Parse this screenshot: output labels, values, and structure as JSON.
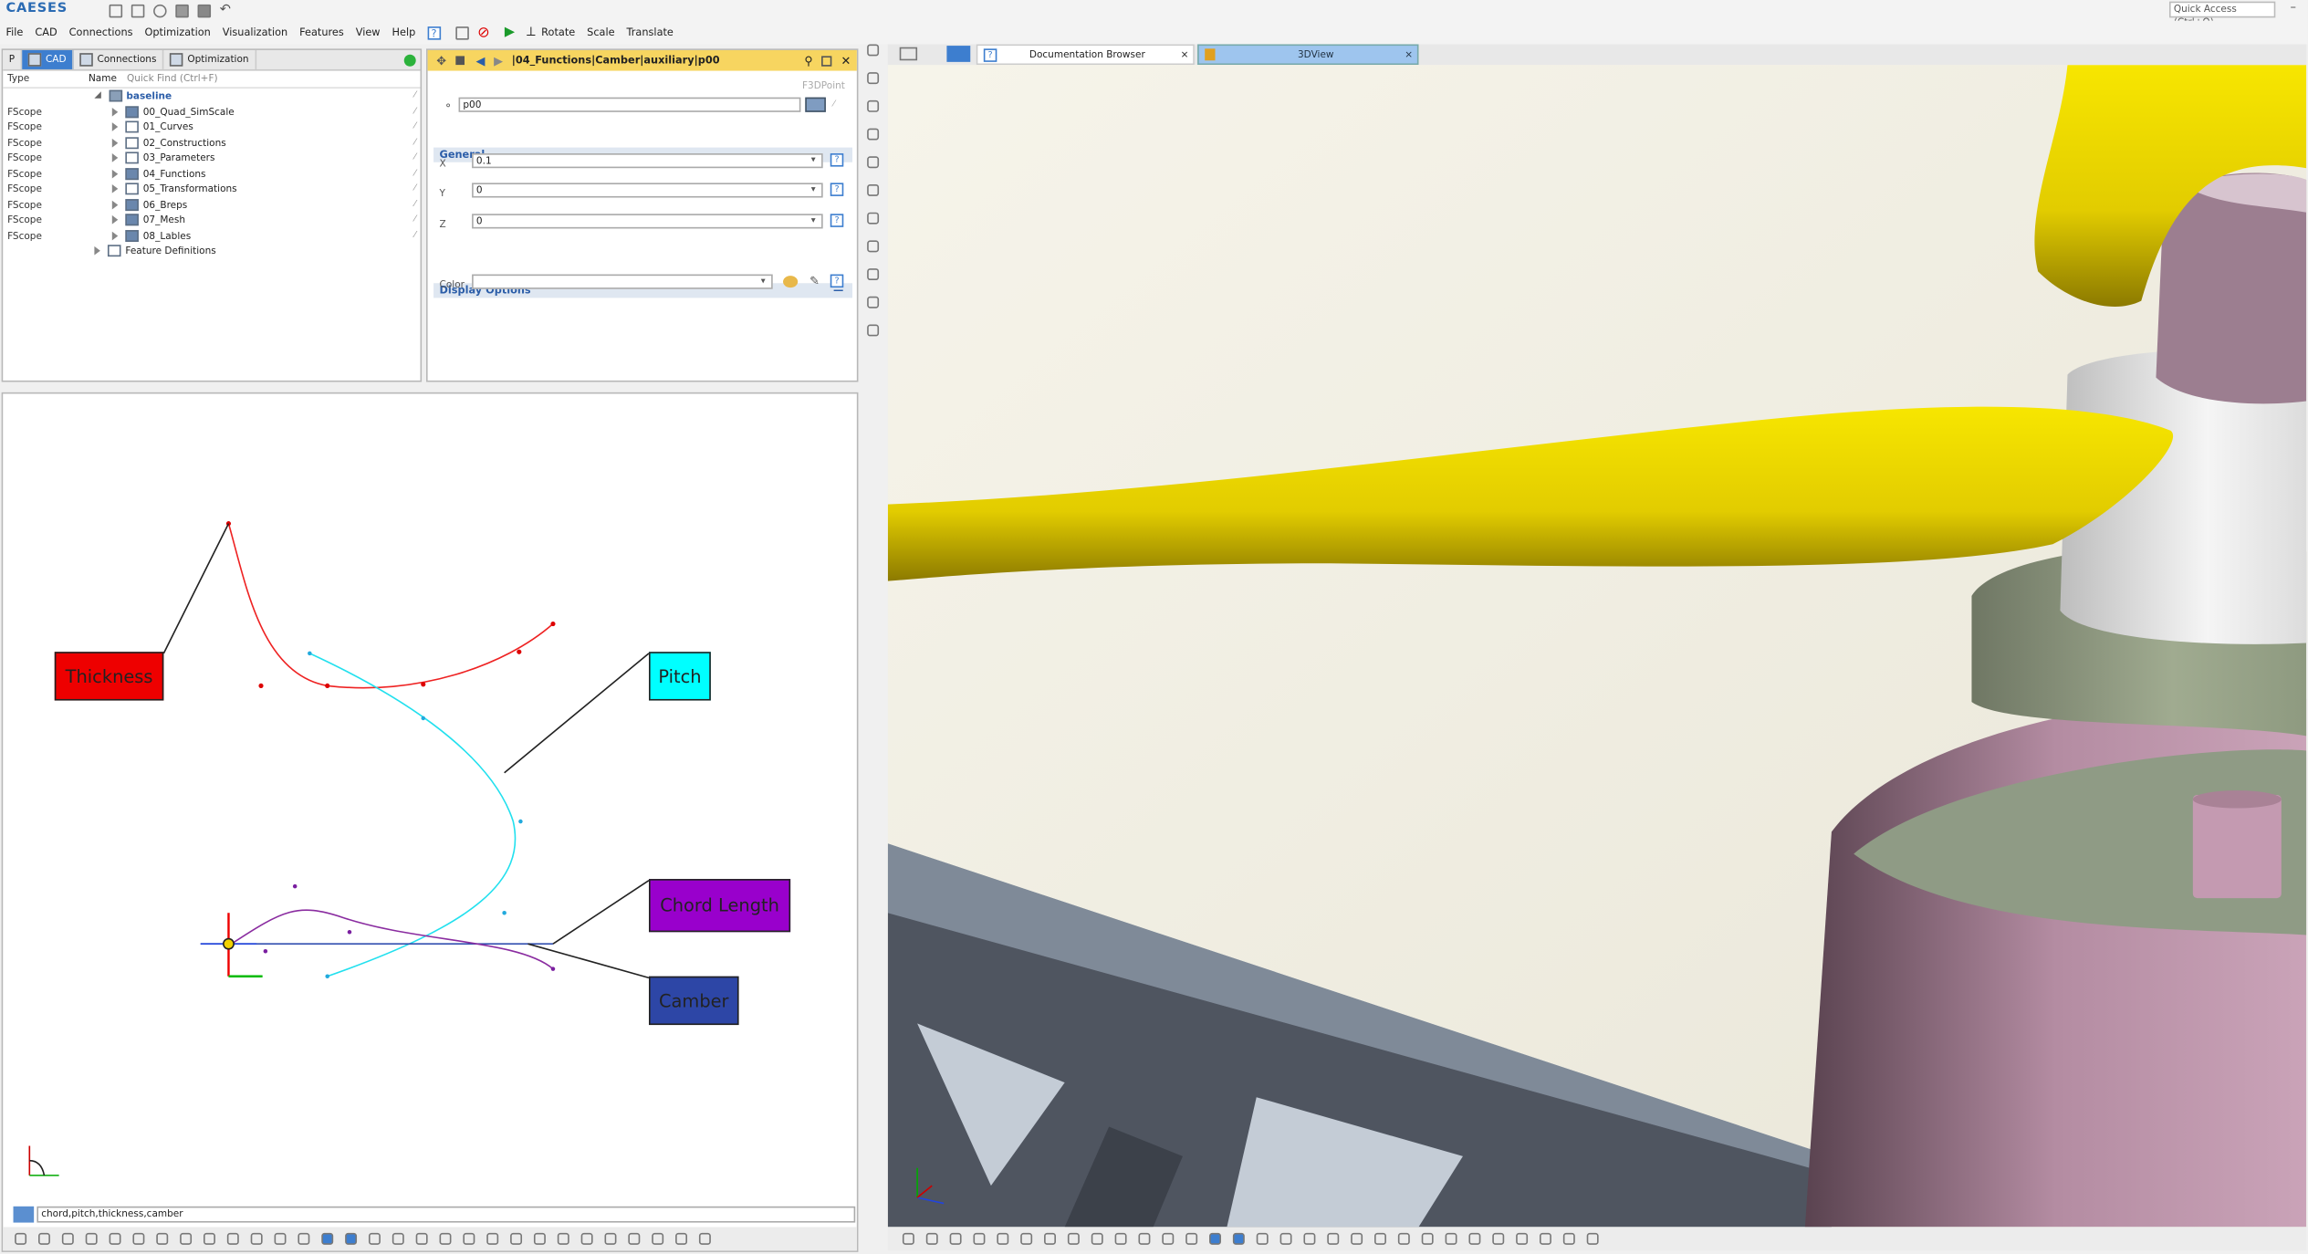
{
  "app": {
    "logo": "CAESES",
    "quick_access": "Quick Access (Ctrl+Q)"
  },
  "menu": {
    "file": "File",
    "cad": "CAD",
    "connections": "Connections",
    "optimization": "Optimization",
    "visualization": "Visualization",
    "features": "Features",
    "view": "View",
    "help": "Help",
    "help_icon": "?",
    "rotate": "Rotate",
    "scale": "Scale",
    "translate": "Translate"
  },
  "left_tabs": {
    "p": "P",
    "cad": "CAD",
    "connections": "Connections",
    "optimization": "Optimization"
  },
  "tree": {
    "col_type": "Type",
    "col_name": "Name",
    "quick_find": "Quick Find (Ctrl+F)",
    "root": "baseline",
    "items": [
      {
        "type": "FScope",
        "name": "00_Quad_SimScale"
      },
      {
        "type": "FScope",
        "name": "01_Curves"
      },
      {
        "type": "FScope",
        "name": "02_Constructions"
      },
      {
        "type": "FScope",
        "name": "03_Parameters"
      },
      {
        "type": "FScope",
        "name": "04_Functions"
      },
      {
        "type": "FScope",
        "name": "05_Transformations"
      },
      {
        "type": "FScope",
        "name": "06_Breps"
      },
      {
        "type": "FScope",
        "name": "07_Mesh"
      },
      {
        "type": "FScope",
        "name": "08_Lables"
      }
    ],
    "feature_definitions": "Feature Definitions"
  },
  "props": {
    "path": "|04_Functions|Camber|auxiliary|p00",
    "object_type": "F3DPoint",
    "name": "p00",
    "general": "General",
    "x_label": "X",
    "x": "0.1",
    "y_label": "Y",
    "y": "0",
    "z_label": "Z",
    "z": "0",
    "display_options": "Display Options",
    "color_label": "Color",
    "color": "",
    "collapse": "—"
  },
  "sketch": {
    "labels": {
      "thickness": "Thickness",
      "pitch": "Pitch",
      "chord": "Chord Length",
      "camber": "Camber"
    },
    "colors": {
      "thickness": "#ee0000",
      "pitch": "#00ffff",
      "chord": "#9900cc",
      "camber": "#2d46a6"
    },
    "filter": "chord,pitch,thickness,camber"
  },
  "view_tabs": {
    "doc": "Documentation Browser",
    "view3d": "3DView",
    "close": "×"
  },
  "colors": {
    "accent": "#3d7ecf",
    "header": "#f7d560",
    "yellow_blade": "#f2dd00",
    "pink": "#b48ca2",
    "green": "#97a386"
  }
}
